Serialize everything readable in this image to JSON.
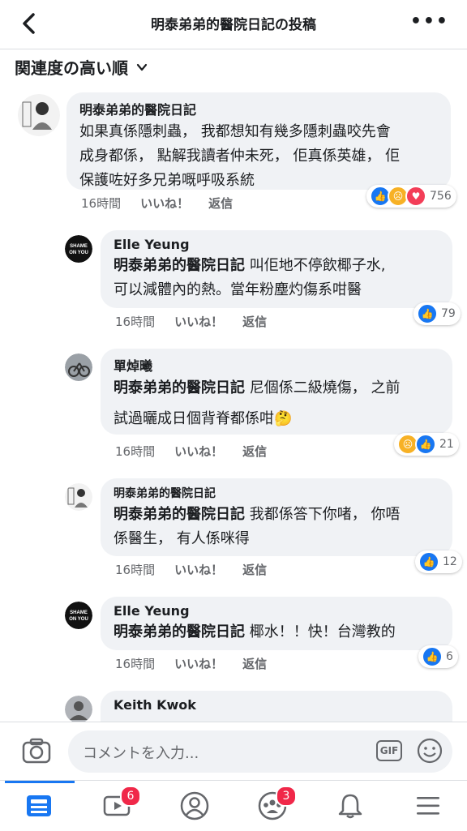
{
  "header": {
    "title": "明泰弟弟的醫院日記の投稿",
    "more": "•••"
  },
  "sort": {
    "label": "関連度の高い順"
  },
  "comments": [
    {
      "name": "明泰弟弟的醫院日記",
      "line1": "如果真係隱刺蟲， 我都想知有幾多隱刺蟲咬先會",
      "line2": "成身都係， 點解我讀者仲未死， 佢真係英雄， 佢",
      "line3": "保護咗好多兄弟嘅呼吸系統",
      "time": "16時間",
      "like": "いいね！",
      "reply": "返信",
      "reactions": [
        "like",
        "sad",
        "love"
      ],
      "count": "756"
    },
    {
      "name": "Elle Yeung",
      "avatar_text": "SHAME ON YOU",
      "tag": "明泰弟弟的醫院日記",
      "line1": " 叫佢地不停飲椰子水,",
      "line2": "可以減體內的熱。當年粉塵灼傷系咁醫",
      "time": "16時間",
      "like": "いいね！",
      "reply": "返信",
      "reactions": [
        "like"
      ],
      "count": "79"
    },
    {
      "name": "單焯曦",
      "tag": "明泰弟弟的醫院日記",
      "line1": " 尼個係二級燒傷， 之前",
      "line2": "試過曬成日個背脊都係咁🤔",
      "time": "16時間",
      "like": "いいね！",
      "reply": "返信",
      "reactions": [
        "sad",
        "like"
      ],
      "count": "21"
    },
    {
      "name": "明泰弟弟的醫院日記",
      "tag": "明泰弟弟的醫院日記",
      "line1": " 我都係答下你啫， 你唔",
      "line2": "係醫生， 有人係咪得",
      "time": "16時間",
      "like": "いいね！",
      "reply": "返信",
      "reactions": [
        "like"
      ],
      "count": "12"
    },
    {
      "name": "Elle Yeung",
      "avatar_text": "SHAME ON YOU",
      "tag": "明泰弟弟的醫院日記",
      "line1": " 椰水！！快！台灣教的",
      "time": "16時間",
      "like": "いいね！",
      "reply": "返信",
      "reactions": [
        "like"
      ],
      "count": "6"
    },
    {
      "name": "Keith Kwok"
    }
  ],
  "composer": {
    "placeholder": "コメントを入力...",
    "gif": "GIF"
  },
  "tabs": {
    "video_badge": "6",
    "groups_badge": "3"
  },
  "colors": {
    "accent": "#1877f2",
    "bubble": "#f0f2f5",
    "badge": "#f02849"
  }
}
